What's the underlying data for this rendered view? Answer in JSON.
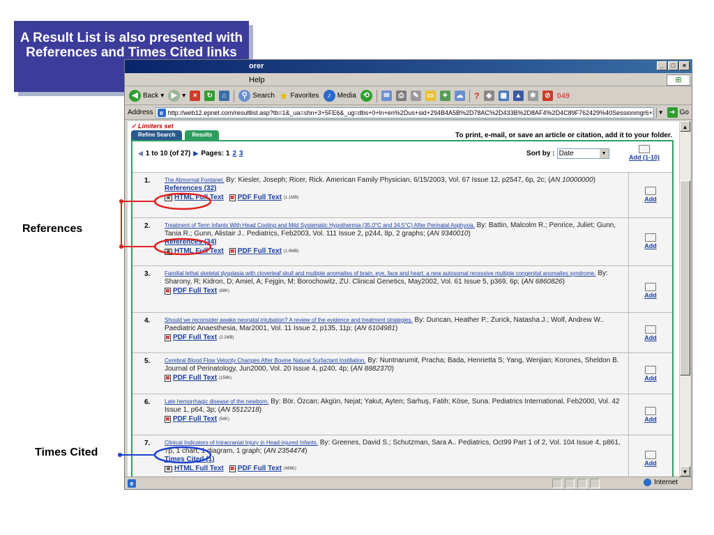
{
  "callout": {
    "text": "A Result List is also presented with References and Times Cited links"
  },
  "annotations": {
    "references": "References",
    "times_cited": "Times Cited"
  },
  "window": {
    "title": "orer",
    "menu": "Help",
    "toolbar": {
      "back": "Back",
      "search": "Search",
      "favorites": "Favorites",
      "media": "Media",
      "counter": "049"
    },
    "address": {
      "label": "Address",
      "url": "http://web12.epnet.com/resultlist.asp?tb=1&_ua=shn+3+5FE6&_ug=dbs+0+ln+en%2Dus+sid+294B4A5B%2D78AC%2D433B%2D8AF4%2D4C89F762429%40Sessionmgr6+3",
      "go": "Go"
    },
    "status": {
      "zone": "Internet"
    }
  },
  "page": {
    "limiters": "✓ Limiters set",
    "tabs": {
      "refine": "Refine Search",
      "results": "Results"
    },
    "print_note": "To print, e-mail, or save an article or citation, add it to your folder.",
    "pager": {
      "range": "1 to 10  (of 27)",
      "pages_label": "Pages: 1",
      "page2": "2",
      "page3": "3"
    },
    "sort": {
      "label": "Sort by :",
      "value": "Date"
    },
    "add_all": "Add (1-10)",
    "add_label": "Add"
  },
  "results": [
    {
      "num": "1.",
      "title": "The Abnormal Fontanel.",
      "citation": " By: Kiesler, Joseph; Ricer, Rick. American Family Physician, 6/15/2003, Vol. 67 Issue 12, p2547, 6p, 2c; (",
      "an": "AN 10000000",
      "close": ")",
      "extra_link": "References (32)",
      "html": "HTML Full Text",
      "pdf": "PDF Full Text",
      "pdf_size": "(1.1MB)"
    },
    {
      "num": "2.",
      "title": "Treatment of Term Infants With Head Cooling and Mild Systematic Hypothermia (35.0°C and 34.5°C) After Perinatal Asphyxia.",
      "citation": " By: Battin, Malcolm R.; Penrice, Juliet; Gunn, Tania R.; Gunn, Alistair J.. Pediatrics, Feb2003, Vol. 111 Issue 2, p244, 8p, 2 graphs; (",
      "an": "AN 9340010",
      "close": ")",
      "extra_link": "References (34)",
      "html": "HTML Full Text",
      "pdf": "PDF Full Text",
      "pdf_size": "(1.9MB)"
    },
    {
      "num": "3.",
      "title": "Familial lethal skeletal dysplasia with cloverleaf skull and multiple anomalies of brain, eye, face and heart: a new autosomal recessive multiple congenital anomalies syndrome.",
      "citation": " By: Sharony, R; Kidron, D; Amiel, A; Fejgin, M; Borochowitz, ZU. Clinical Genetics, May2002, Vol. 61 Issue 5, p369, 6p; (",
      "an": "AN 6860826",
      "close": ")",
      "pdf": "PDF Full Text",
      "pdf_size": "(88K)"
    },
    {
      "num": "4.",
      "title": "Should we reconsider awake neonatal intubation? A review of the evidence and treatment strategies.",
      "citation": " By: Duncan, Heather P.; Zurick, Natasha J.; Wolf, Andrew W.. Paediatric Anaesthesia, Mar2001, Vol. 11 Issue 2, p135, 11p; (",
      "an": "AN 6104981",
      "close": ")",
      "pdf": "PDF Full Text",
      "pdf_size": "(2.2MB)"
    },
    {
      "num": "5.",
      "title": "Cerebral Blood Flow Velocity Changes After Bovine Natural Surfactant Instillation.",
      "citation": " By: Nuntnarumit, Pracha; Bada, Henrietta S; Yang, Wenjian; Korones, Sheldon B. Journal of Perinatology, Jun2000, Vol. 20 Issue 4, p240, 4p; (",
      "an": "AN 8882370",
      "close": ")",
      "pdf": "PDF Full Text",
      "pdf_size": "(159K)"
    },
    {
      "num": "6.",
      "title": "Late hemorrhagic disease of the newborn.",
      "citation": " By: Bör, Özcan; Akgün, Nejat; Yakut, Ayten; Sarhuş, Fatih; Köse, Suna. Pediatrics International, Feb2000, Vol. 42 Issue 1, p64, 3p; (",
      "an": "AN 5512218",
      "close": ")",
      "pdf": "PDF Full Text",
      "pdf_size": "(54K)"
    },
    {
      "num": "7.",
      "title": "Clinical Indicators of Intracranial Injury in Head-injured Infants.",
      "citation": " By: Greenes, David S.; Schutzman, Sara A.. Pediatrics, Oct99 Part 1 of 2, Vol. 104 Issue 4, p861, 7p, 1 chart, 1 diagram, 1 graph; (",
      "an": "AN 2354474",
      "close": ")",
      "extra_link": "Times Cited (1)",
      "html": "HTML Full Text",
      "pdf": "PDF Full Text",
      "pdf_size": "(486K)"
    }
  ],
  "colors": {
    "callout": "#3c3c9a",
    "ref_marker": "#e02020",
    "times_marker": "#1a3fd0",
    "frame": "#2e9e5e"
  }
}
